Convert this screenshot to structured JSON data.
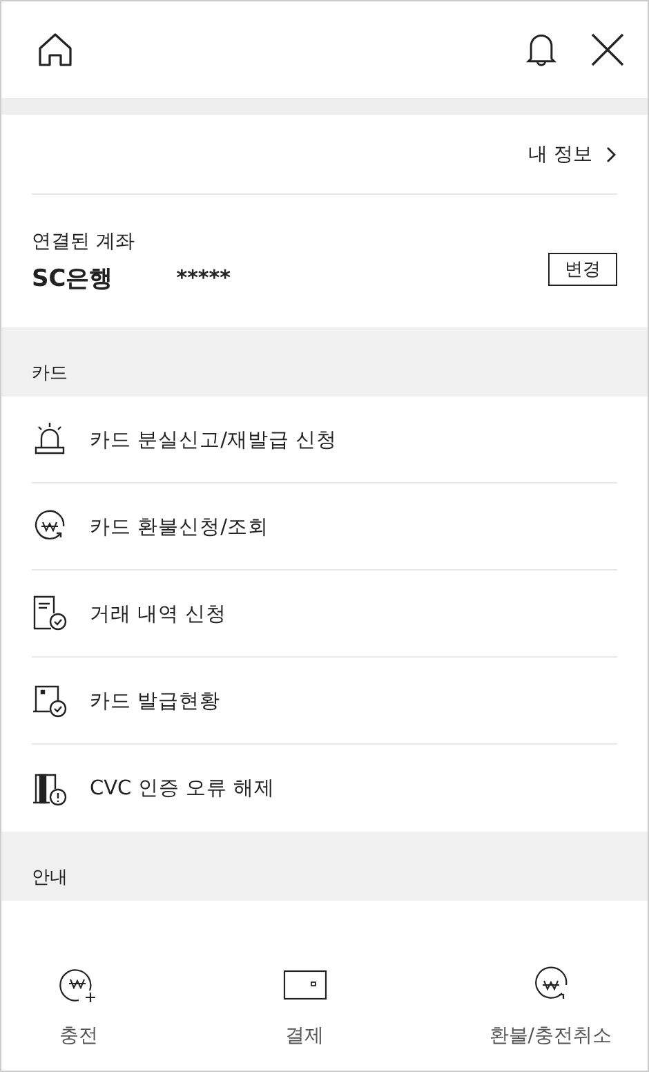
{
  "my_info_link": "내 정보",
  "account": {
    "label": "연결된 계좌",
    "bank": "SC은행",
    "number": "*****",
    "change_button": "변경"
  },
  "sections": [
    {
      "title": "카드",
      "items": [
        {
          "label": "카드 분실신고/재발급 신청",
          "kind": "siren"
        },
        {
          "label": "카드 환불신청/조회",
          "kind": "refund"
        },
        {
          "label": "거래 내역 신청",
          "kind": "document"
        },
        {
          "label": "카드 발급현황",
          "kind": "card-status"
        },
        {
          "label": "CVC 인증 오류 해제",
          "kind": "cvc"
        }
      ]
    },
    {
      "title": "안내"
    }
  ],
  "bottom_nav": [
    {
      "label": "충전",
      "kind": "charge"
    },
    {
      "label": "결제",
      "kind": "pay"
    },
    {
      "label": "환불/충전취소",
      "kind": "refund"
    }
  ]
}
